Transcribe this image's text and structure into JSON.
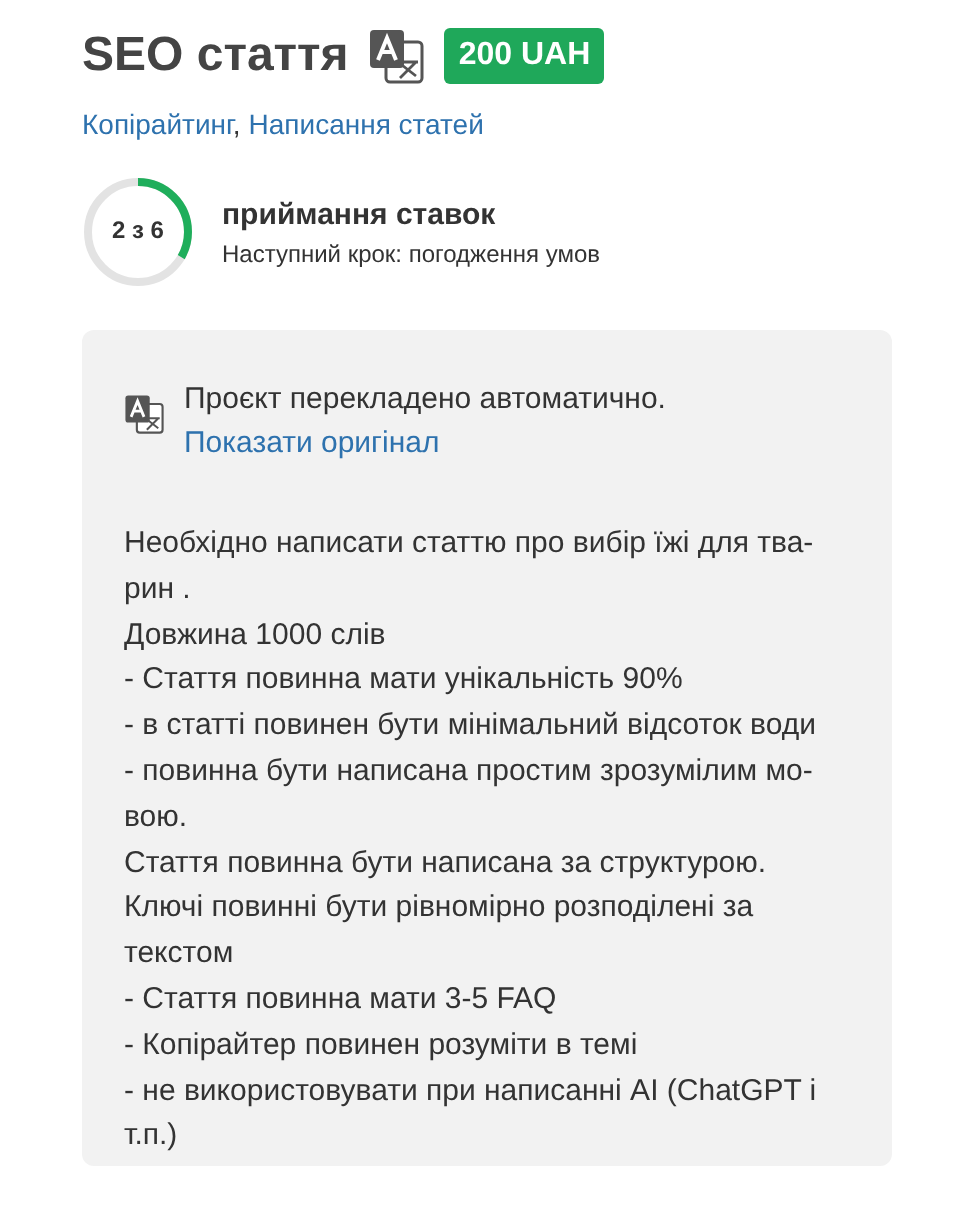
{
  "title": "SEO стаття",
  "price": "200 UAH",
  "categories": [
    {
      "label": "Копірайтинг",
      "separator": ","
    },
    {
      "label": "Написання статей"
    }
  ],
  "progress": {
    "counter": "2 з 6",
    "stage": "приймання ставок",
    "next_step": "Наступний крок: погодження умов"
  },
  "translation_notice": {
    "text": "Проєкт перекладено автоматично.",
    "link": "Показати оригінал"
  },
  "description_lines": [
    "Необхідно написати статтю про вибір їжі для тва-",
    "рин .",
    "Довжина 1000 слів",
    "- Стаття повинна мати унікальність 90%",
    "- в статті повинен бути мінімальний відсоток води",
    "- повинна бути написана простим зрозумілим мо-",
    "вою.",
    "Стаття повинна бути написана за структурою.",
    "Ключі повинні бути рівномірно розподілені за",
    "текстом",
    "- Стаття повинна мати 3-5 FAQ",
    "- Копірайтер повинен розуміти в темі",
    "- не використовувати при написанні AI (ChatGPT і",
    "т.п.)"
  ]
}
